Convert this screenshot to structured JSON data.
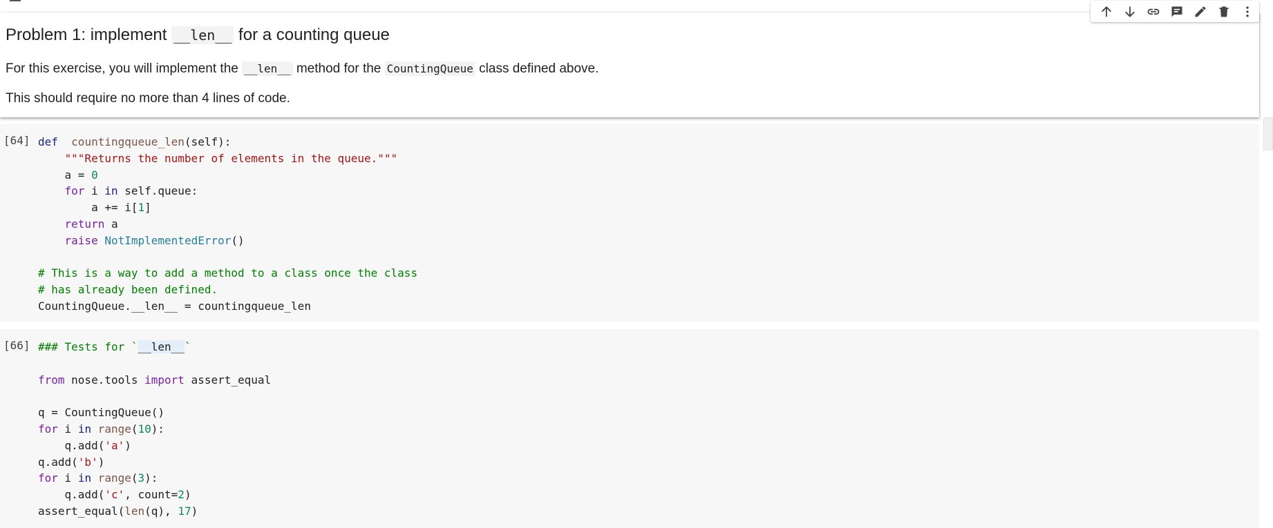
{
  "text_cell": {
    "heading": {
      "pre": "Problem 1: implement ",
      "code": "__len__",
      "post": " for a counting queue"
    },
    "para1": {
      "pre": "For this exercise, you will implement the ",
      "code1": "__len__",
      "mid": " method for the ",
      "code2": "CountingQueue",
      "post": " class defined above."
    },
    "para2": "This should require no more than 4 lines of code."
  },
  "toolbar": [
    {
      "name": "move-up-icon"
    },
    {
      "name": "move-down-icon"
    },
    {
      "name": "link-icon"
    },
    {
      "name": "comment-icon"
    },
    {
      "name": "edit-icon"
    },
    {
      "name": "delete-icon"
    },
    {
      "name": "more-options-icon"
    }
  ],
  "cells": [
    {
      "prompt": "[64]",
      "lines": [
        [
          [
            "kd",
            "def"
          ],
          [
            "",
            "  "
          ],
          [
            "fn",
            "countingqueue_len"
          ],
          [
            "",
            "(self):"
          ]
        ],
        [
          [
            "",
            "    "
          ],
          [
            "s",
            "\"\"\"Returns the number of elements in the queue.\"\"\""
          ]
        ],
        [
          [
            "",
            "    a = "
          ],
          [
            "n",
            "0"
          ]
        ],
        [
          [
            "",
            "    "
          ],
          [
            "k",
            "for"
          ],
          [
            "",
            " i "
          ],
          [
            "kd",
            "in"
          ],
          [
            "",
            " self.queue:"
          ]
        ],
        [
          [
            "",
            "        a += i["
          ],
          [
            "n",
            "1"
          ],
          [
            "",
            "]"
          ]
        ],
        [
          [
            "",
            "    "
          ],
          [
            "k",
            "return"
          ],
          [
            "",
            " a"
          ]
        ],
        [
          [
            "",
            "    "
          ],
          [
            "k",
            "raise"
          ],
          [
            "",
            " "
          ],
          [
            "cls",
            "NotImplementedError"
          ],
          [
            "",
            "()"
          ]
        ],
        [
          [
            "",
            ""
          ]
        ],
        [
          [
            "c",
            "# This is a way to add a method to a class once the class"
          ]
        ],
        [
          [
            "c",
            "# has already been defined."
          ]
        ],
        [
          [
            "",
            "CountingQueue.__len__ = countingqueue_len"
          ]
        ]
      ]
    },
    {
      "prompt": "[66]",
      "lines": [
        [
          [
            "c",
            "### Tests for `"
          ],
          [
            "hl",
            "__len__"
          ],
          [
            "c",
            "`"
          ]
        ],
        [
          [
            "",
            ""
          ]
        ],
        [
          [
            "k",
            "from"
          ],
          [
            "",
            " nose.tools "
          ],
          [
            "k",
            "import"
          ],
          [
            "",
            " assert_equal"
          ]
        ],
        [
          [
            "",
            ""
          ]
        ],
        [
          [
            "",
            "q = CountingQueue()"
          ]
        ],
        [
          [
            "k",
            "for"
          ],
          [
            "",
            " i "
          ],
          [
            "kd",
            "in"
          ],
          [
            "",
            " "
          ],
          [
            "bi",
            "range"
          ],
          [
            "",
            "("
          ],
          [
            "n",
            "10"
          ],
          [
            "",
            "):"
          ]
        ],
        [
          [
            "",
            "    q.add("
          ],
          [
            "st",
            "'a'"
          ],
          [
            "",
            ")"
          ]
        ],
        [
          [
            "",
            "q.add("
          ],
          [
            "st",
            "'b'"
          ],
          [
            "",
            ")"
          ]
        ],
        [
          [
            "k",
            "for"
          ],
          [
            "",
            " i "
          ],
          [
            "kd",
            "in"
          ],
          [
            "",
            " "
          ],
          [
            "bi",
            "range"
          ],
          [
            "",
            "("
          ],
          [
            "n",
            "3"
          ],
          [
            "",
            "):"
          ]
        ],
        [
          [
            "",
            "    q.add("
          ],
          [
            "st",
            "'c'"
          ],
          [
            "",
            ", count="
          ],
          [
            "n",
            "2"
          ],
          [
            "",
            ")"
          ]
        ],
        [
          [
            "",
            "assert_equal("
          ],
          [
            "bi",
            "len"
          ],
          [
            "",
            "(q), "
          ],
          [
            "n",
            "17"
          ],
          [
            "",
            ")"
          ]
        ]
      ]
    }
  ]
}
